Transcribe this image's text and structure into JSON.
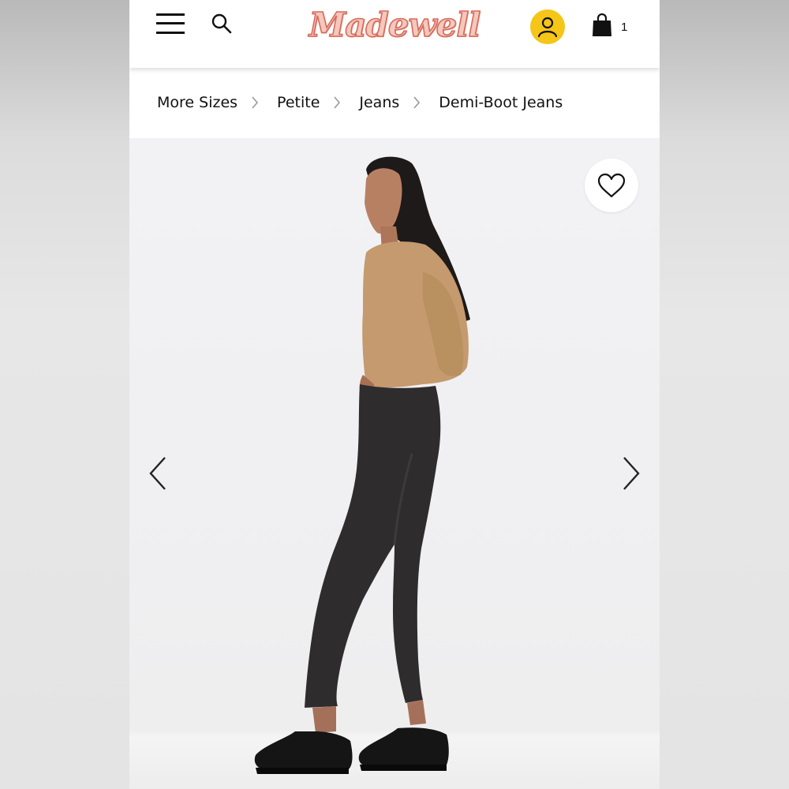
{
  "header": {
    "logo_text": "Madewell",
    "bag_count": "1",
    "icons": {
      "menu": "hamburger-menu-icon",
      "search": "search-icon",
      "account": "user-icon",
      "bag": "shopping-bag-icon"
    },
    "account_color": "#f5c518",
    "logo_color": "#d8695a"
  },
  "breadcrumb": {
    "items": [
      {
        "label": "More Sizes"
      },
      {
        "label": "Petite"
      },
      {
        "label": "Jeans"
      },
      {
        "label": "Demi-Boot Jeans"
      }
    ]
  },
  "product": {
    "favorite_icon": "heart-outline-icon",
    "prev_icon": "chevron-left-icon",
    "next_icon": "chevron-right-icon"
  }
}
